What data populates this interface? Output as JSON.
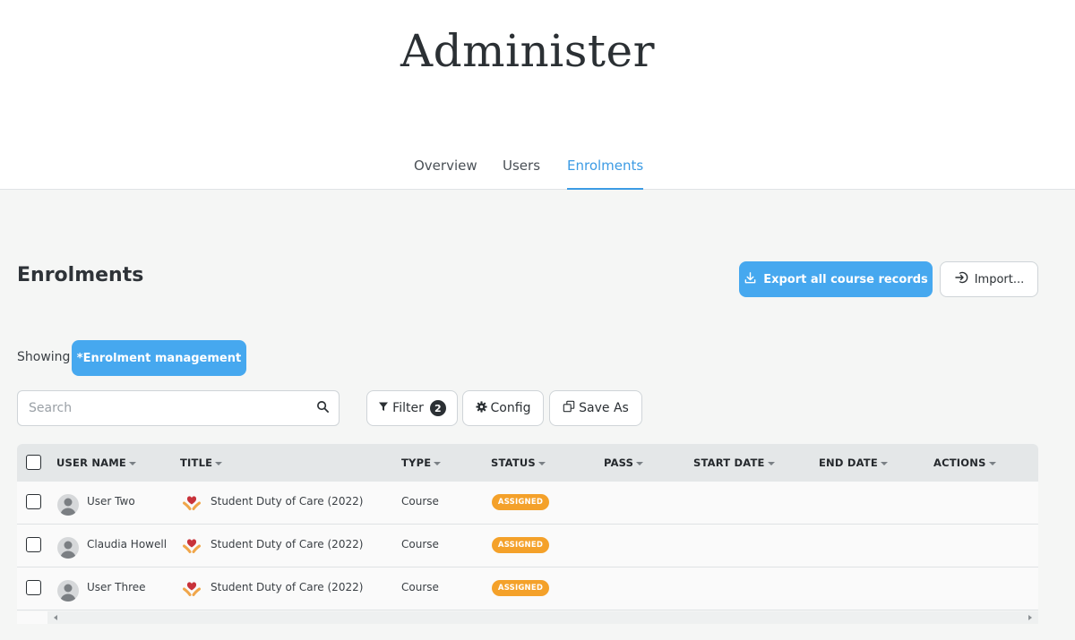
{
  "page": {
    "title": "Administer"
  },
  "tabs": [
    {
      "label": "Overview",
      "active": false
    },
    {
      "label": "Users",
      "active": false
    },
    {
      "label": "Enrolments",
      "active": true
    }
  ],
  "section": {
    "title": "Enrolments"
  },
  "actions": {
    "export_label": "Export all course records",
    "import_label": "Import..."
  },
  "showing": {
    "label": "Showing:",
    "view": "*Enrolment management"
  },
  "search": {
    "placeholder": "Search",
    "value": ""
  },
  "toolbar": {
    "filter_label": "Filter",
    "filter_count": "2",
    "config_label": "Config",
    "save_as_label": "Save As"
  },
  "table": {
    "columns": [
      "USER NAME",
      "TITLE",
      "TYPE",
      "STATUS",
      "PASS",
      "START DATE",
      "END DATE",
      "ACTIONS"
    ],
    "rows": [
      {
        "user": "User Two",
        "title": "Student Duty of Care (2022)",
        "type": "Course",
        "status": "ASSIGNED"
      },
      {
        "user": "Claudia Howell",
        "title": "Student Duty of Care (2022)",
        "type": "Course",
        "status": "ASSIGNED"
      },
      {
        "user": "User Three",
        "title": "Student Duty of Care (2022)",
        "type": "Course",
        "status": "ASSIGNED"
      }
    ]
  },
  "colors": {
    "accent": "#46a8ef",
    "status_assigned": "#f4a12a",
    "tab_active": "#3c9be4"
  },
  "icons": {
    "export": "download-icon",
    "import": "sign-in-arrow-icon",
    "search": "search-icon",
    "filter": "funnel-icon",
    "config": "gear-icon",
    "save_as": "copy-icon",
    "avatar": "user-silhouette-icon",
    "course": "heart-hands-icon"
  }
}
